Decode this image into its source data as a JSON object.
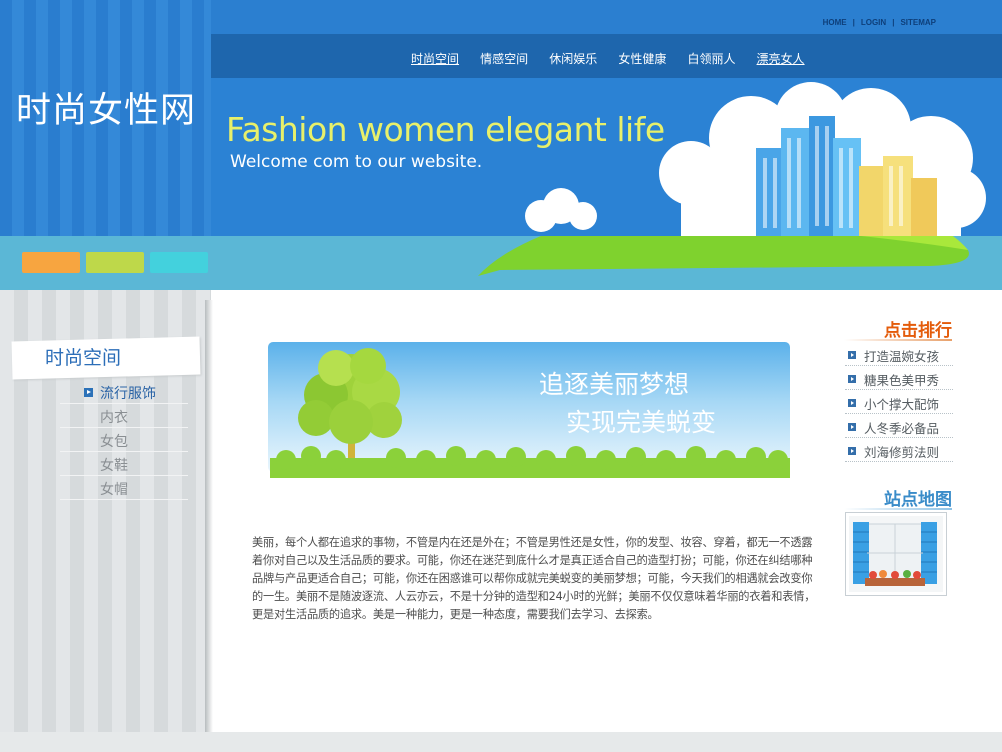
{
  "site": {
    "logo": "时尚女性网"
  },
  "top_links": [
    "HOME",
    "LOGIN",
    "SITEMAP"
  ],
  "top_link_separator": "|",
  "nav": {
    "items": [
      "时尚空间",
      "情感空间",
      "休闲娱乐",
      "女性健康",
      "白领丽人",
      "漂亮女人"
    ]
  },
  "banner": {
    "title": "Fashion women elegant life",
    "subtitle": "Welcome com to our  website."
  },
  "strip_colors": [
    "#f7a540",
    "#bed84a",
    "#43d1dd"
  ],
  "sidebar": {
    "title": "时尚空间",
    "items": [
      "流行服饰",
      "内衣",
      "女包",
      "女鞋",
      "女帽"
    ]
  },
  "center": {
    "banner_line1": "追逐美丽梦想",
    "banner_line2": "实现完美蜕变",
    "paragraph": "美丽，每个人都在追求的事物，不管是内在还是外在；不管是男性还是女性，你的发型、妆容、穿着，都无一不透露着你对自己以及生活品质的要求。可能，你还在迷茫到底什么才是真正适合自己的造型打扮；可能，你还在纠结哪种品牌与产品更适合自己；可能，你还在困惑谁可以帮你成就完美蜕变的美丽梦想；可能，今天我们的相遇就会改变你的一生。美丽不是随波逐流、人云亦云，不是十分钟的造型和24小时的光鲜；美丽不仅仅意味着华丽的衣着和表情，更是对生活品质的追求。美是一种能力，更是一种态度，需要我们去学习、去探索。"
  },
  "rank": {
    "heading": "点击排行",
    "items": [
      "打造温婉女孩",
      "糖果色美甲秀",
      "小个撑大配饰",
      "人冬季必备品",
      "刘海修剪法则"
    ]
  },
  "sitemap": {
    "heading": "站点地图"
  },
  "colors": {
    "header_blue": "#2b7fd0",
    "nav_blue": "#1e66ad",
    "banner_title": "#e8f06a",
    "rank_heading": "#e45c0b",
    "map_heading": "#3a8cc9"
  }
}
